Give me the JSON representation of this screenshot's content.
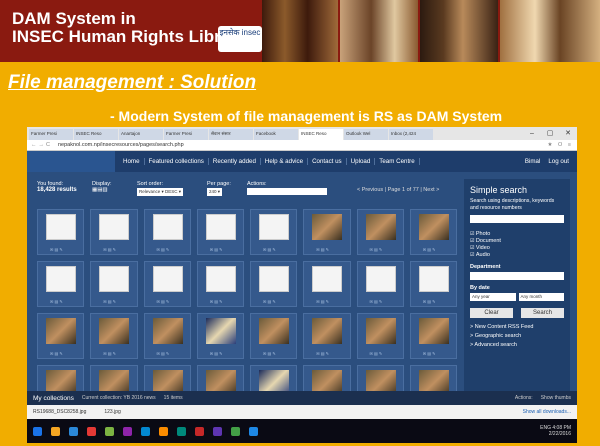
{
  "header": {
    "line1": "DAM System in",
    "line2": "INSEC Human Rights Library",
    "logo_text": "इनसेक insec"
  },
  "slide": {
    "title": "File management  : Solution",
    "subtitle": "- Modern System of file management is RS as DAM System"
  },
  "browser": {
    "tabs": [
      "Farmer Presi",
      "INSEC Reso",
      "Anartajon",
      "Farmer Presi",
      "सेवान संसार",
      "Facebook",
      "INSEC Reso",
      "Outlook Wel",
      "Inbox (2,424"
    ],
    "url": "nepaknol.com.np/insecresources/pages/search.php",
    "win_buttons": [
      "–",
      "▢",
      "✕"
    ]
  },
  "app": {
    "menu": [
      "Home",
      "Featured collections",
      "Recently added",
      "Help & advice",
      "Contact us",
      "Upload",
      "Team Centre"
    ],
    "user": "Bimal",
    "logout": "Log out",
    "found_label": "You found:",
    "found_value": "18,428 results",
    "display_label": "Display:",
    "sort_label": "Sort order:",
    "sort_value": "Relevance ▾  DESC ▾",
    "perpage_label": "Per page:",
    "perpage_value": "240 ▾",
    "actions_label": "Actions:",
    "pager": "< Previous | Page 1 of 77 | Next >"
  },
  "results": [
    {
      "kind": "doc"
    },
    {
      "kind": "doc"
    },
    {
      "kind": "doc"
    },
    {
      "kind": "doc"
    },
    {
      "kind": "doc"
    },
    {
      "kind": "photo"
    },
    {
      "kind": "photo"
    },
    {
      "kind": "photo"
    },
    {
      "kind": "doc"
    },
    {
      "kind": "doc"
    },
    {
      "kind": "doc"
    },
    {
      "kind": "doc"
    },
    {
      "kind": "doc"
    },
    {
      "kind": "doc"
    },
    {
      "kind": "doc"
    },
    {
      "kind": "doc"
    },
    {
      "kind": "photo"
    },
    {
      "kind": "photo"
    },
    {
      "kind": "photo"
    },
    {
      "kind": "blue"
    },
    {
      "kind": "photo"
    },
    {
      "kind": "photo"
    },
    {
      "kind": "photo"
    },
    {
      "kind": "photo"
    },
    {
      "kind": "photo"
    },
    {
      "kind": "photo"
    },
    {
      "kind": "photo"
    },
    {
      "kind": "photo"
    },
    {
      "kind": "blue"
    },
    {
      "kind": "photo"
    },
    {
      "kind": "photo"
    },
    {
      "kind": "photo"
    }
  ],
  "sidebar": {
    "title": "Simple search",
    "hint": "Search using descriptions, keywords and resource numbers",
    "types": [
      "Photo",
      "Document",
      "Video",
      "Audio"
    ],
    "department": "Department",
    "by_date": "By date",
    "any_year": "Any year",
    "any_month": "Any month",
    "clear": "Clear",
    "search": "Search",
    "links": [
      "> New Content RSS Feed",
      "> Geographic search",
      "> Advanced search"
    ]
  },
  "collections": {
    "title": "My collections",
    "current": "Current collection: YB 2016 news",
    "items": "15 items",
    "actions": "Actions:",
    "thumbs": "Show thumbs"
  },
  "downloads": {
    "file1": "RS19688_DSC8258.jpg",
    "file2": "123.jpg",
    "show_all": "Show all downloads..."
  },
  "clock": {
    "time": "4:08 PM",
    "date": "2/22/2016",
    "lang": "ENG"
  },
  "taskbar_colors": [
    "#1a73e8",
    "#f5a623",
    "#2b88d8",
    "#e53935",
    "#7cb342",
    "#8e24aa",
    "#0288d1",
    "#fb8c00",
    "#00897b",
    "#c62828",
    "#5e35b1",
    "#43a047",
    "#1e88e5"
  ]
}
